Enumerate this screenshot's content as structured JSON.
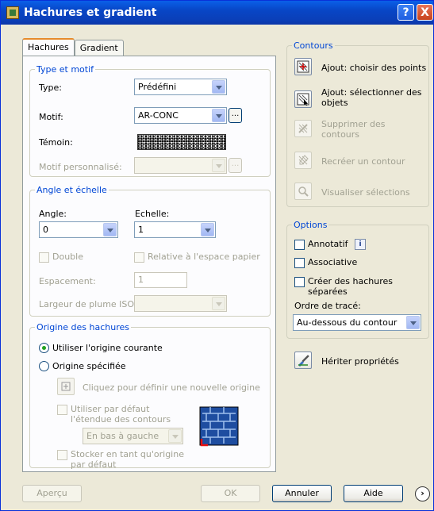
{
  "window": {
    "title": "Hachures et gradient",
    "help": "?",
    "close": "X"
  },
  "tabs": [
    "Hachures",
    "Gradient"
  ],
  "type_motif": {
    "legend": "Type et motif",
    "type_label": "Type:",
    "type_value": "Prédéfini",
    "motif_label": "Motif:",
    "motif_value": "AR-CONC",
    "motif_btn": "...",
    "temoin_label": "Témoin:",
    "motif_perso_label": "Motif personnalisé:",
    "motif_perso_btn": "..."
  },
  "angle_echelle": {
    "legend": "Angle et échelle",
    "angle_label": "Angle:",
    "angle_value": "0",
    "echelle_label": "Echelle:",
    "echelle_value": "1",
    "double_label": "Double",
    "relative_label": "Relative à l'espace papier",
    "espacement_label": "Espacement:",
    "espacement_value": "1",
    "largeur_label": "Largeur de plume ISO:"
  },
  "origine": {
    "legend": "Origine des hachures",
    "courante_label": "Utiliser l'origine courante",
    "specifiee_label": "Origine spécifiée",
    "cliquez_label": "Cliquez pour définir une nouvelle origine",
    "defaut_label": "Utiliser par défaut l'étendue des contours",
    "position_value": "En bas à gauche",
    "stocker_label": "Stocker en tant qu'origine par défaut"
  },
  "contours": {
    "legend": "Contours",
    "items": [
      {
        "label": "Ajout: choisir des points",
        "icon": "pick-points-icon",
        "enabled": true
      },
      {
        "label": "Ajout: sélectionner des objets",
        "icon": "select-objects-icon",
        "enabled": true
      },
      {
        "label": "Supprimer des contours",
        "icon": "remove-boundaries-icon",
        "enabled": false
      },
      {
        "label": "Recréer un contour",
        "icon": "recreate-boundary-icon",
        "enabled": false
      },
      {
        "label": "Visualiser sélections",
        "icon": "view-selections-icon",
        "enabled": false
      }
    ]
  },
  "options": {
    "legend": "Options",
    "annotatif_label": "Annotatif",
    "associative_label": "Associative",
    "separees_label": "Créer des hachures séparées",
    "ordre_label": "Ordre de tracé:",
    "ordre_value": "Au-dessous du contour"
  },
  "heriter_label": "Hériter propriétés",
  "footer": {
    "apercu": "Aperçu",
    "ok": "OK",
    "annuler": "Annuler",
    "aide": "Aide",
    "more": "›"
  }
}
